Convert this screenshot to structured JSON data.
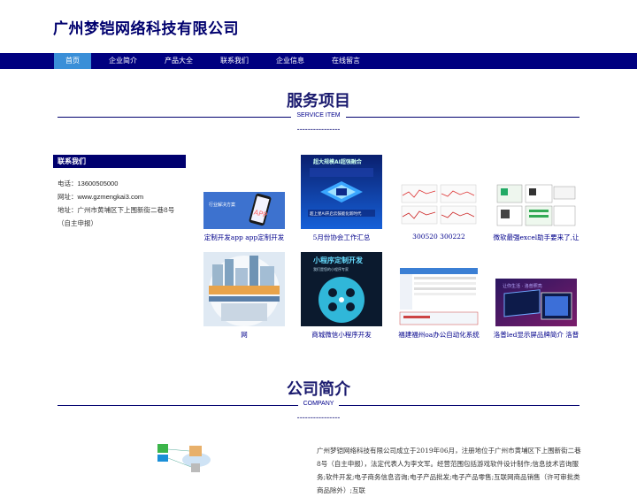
{
  "site": {
    "title": "广州梦铠网络科技有限公司"
  },
  "nav": {
    "items": [
      "首页",
      "企业简介",
      "产品大全",
      "联系我们",
      "企业信息",
      "在线留言"
    ]
  },
  "services": {
    "title": "服务项目",
    "subtitle": "SERVICE ITEM",
    "dashes": "----------------"
  },
  "contact": {
    "heading": "联系我们",
    "phone_label": "电话：",
    "phone": "13600505000",
    "web_label": "网址：",
    "web": "www.gzmengkai3.com",
    "addr_label": "地址：",
    "addr": "广州市黄埔区下上围新街二巷8号（自主申报）"
  },
  "products": [
    {
      "caption": "定制开发app app定制开发",
      "icon": "app-dev-image"
    },
    {
      "caption": "5月份协会工作汇总",
      "icon": "ai-chip-image"
    },
    {
      "caption": "300520 300222",
      "icon": "line-charts-image"
    },
    {
      "caption": "微软最强excel助手要来了,让",
      "icon": "excel-screens-image"
    },
    {
      "caption": "网",
      "icon": "city-skyline-image"
    },
    {
      "caption": "商城微信小程序开发",
      "icon": "mini-program-image"
    },
    {
      "caption": "福建福州oa办公自动化系统",
      "icon": "oa-screens-image"
    },
    {
      "caption": "洛普led显示屏品牌简介 洛普",
      "icon": "led-display-image"
    }
  ],
  "product_banners": {
    "app": "行业解决方案",
    "ai_top": "超大规模AI超强融合",
    "ai_bottom": "超上星AI开启云鼓能化新时代",
    "mini_title": "小程序定制开发",
    "mini_sub": "我们是您的小程序专家",
    "led": "让你生活 · 洛普照亮"
  },
  "company": {
    "title": "公司简介",
    "subtitle": "COMPANY",
    "dashes": "----------------",
    "text": "广州梦铠网络科技有限公司成立于2019年06月，注册地位于广州市黄埔区下上围新街二巷8号（自主申报），法定代表人为李文军。经营范围包括游戏软件设计制作;信息技术咨询服务;软件开发;电子商务信息咨询;电子产品批发;电子产品零售;互联网商品销售（许可审批类商品除外）;互联"
  },
  "colors": {
    "navy": "#000080",
    "active_tab": "#3a8fd8",
    "title": "#1a1a6e"
  }
}
